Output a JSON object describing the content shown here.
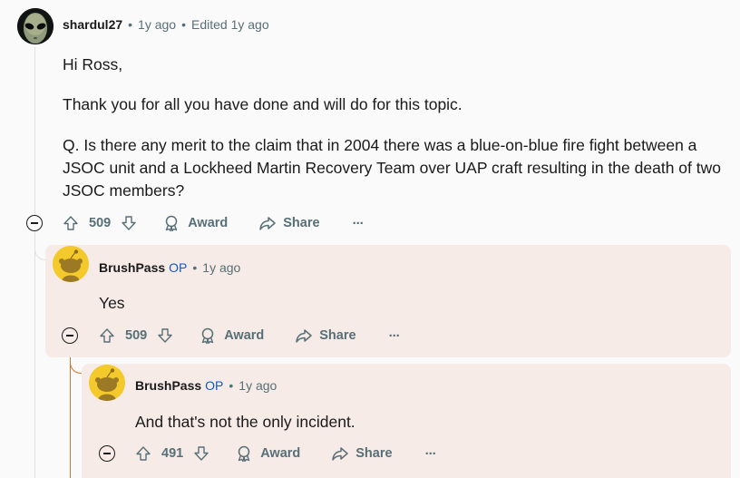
{
  "comments": [
    {
      "author": "shardul27",
      "time": "1y ago",
      "edited": "Edited 1y ago",
      "paragraphs": [
        "Hi Ross,",
        "Thank you for all you have done and will do for this topic.",
        "Q. Is there any merit to the claim that in 2004 there was a blue-on-blue fire fight between a",
        "JSOC unit and a Lockheed Martin Recovery Team over UAP craft resulting in the death of two",
        "JSOC members?"
      ],
      "votes": "509",
      "award_label": "Award",
      "share_label": "Share",
      "more_label": "···"
    },
    {
      "author": "BrushPass",
      "op": "OP",
      "time": "1y ago",
      "text": "Yes",
      "votes": "509",
      "award_label": "Award",
      "share_label": "Share",
      "more_label": "···"
    },
    {
      "author": "BrushPass",
      "op": "OP",
      "time": "1y ago",
      "text": "And that's not the only incident.",
      "votes": "491",
      "award_label": "Award",
      "share_label": "Share",
      "more_label": "···"
    }
  ],
  "separator": "•",
  "colors": {
    "op": "#0f58c7",
    "highlight": "#f7ebe7",
    "thread_red": "#d6732c"
  }
}
